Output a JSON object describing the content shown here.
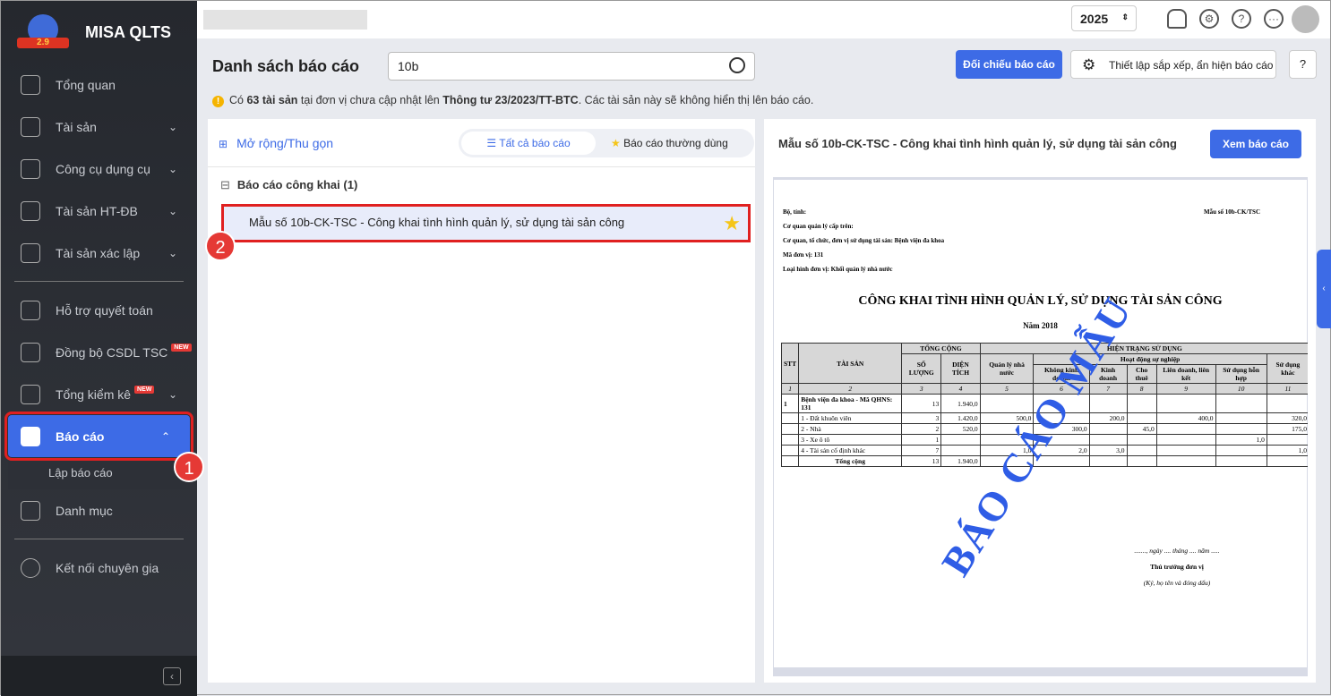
{
  "app": {
    "name": "MISA QLTS",
    "logo_text": "2.9"
  },
  "sidebar": {
    "items": [
      {
        "label": "Tổng quan"
      },
      {
        "label": "Tài sản"
      },
      {
        "label": "Công cụ dụng cụ"
      },
      {
        "label": "Tài sản HT-ĐB"
      },
      {
        "label": "Tài sản xác lập"
      },
      {
        "label": "Hỗ trợ quyết toán"
      },
      {
        "label": "Đồng bộ CSDL TSC",
        "badge": "NEW"
      },
      {
        "label": "Tổng kiểm kê",
        "badge": "NEW"
      },
      {
        "label": "Báo cáo"
      },
      {
        "label": "Lập báo cáo"
      },
      {
        "label": "Danh mục"
      },
      {
        "label": "Kết nối chuyên gia"
      }
    ]
  },
  "callouts": [
    "1",
    "2"
  ],
  "topbar": {
    "year": "2025"
  },
  "page": {
    "title": "Danh sách báo cáo",
    "search_value": "10b",
    "compare_button": "Đối chiếu báo cáo",
    "settings_button": "Thiết lập sắp xếp, ẩn hiện báo cáo",
    "info_pre": "Có ",
    "info_count": "63 tài sản",
    "info_mid": " tại đơn vị chưa cập nhật lên ",
    "info_circular": "Thông tư 23/2023/TT-BTC",
    "info_post": ". Các tài sản này sẽ không hiển thị lên báo cáo."
  },
  "list": {
    "expand_label": "Mở rộng/Thu gọn",
    "tab_all": "Tất cả báo cáo",
    "tab_frequent": "Báo cáo thường dùng",
    "group": "Báo cáo công khai (1)",
    "report": "Mẫu số 10b-CK-TSC - Công khai tình hình quản lý, sử dụng tài sản công"
  },
  "preview": {
    "title": "Mẫu số 10b-CK-TSC - Công khai tình hình quản lý, sử dụng tài sản công",
    "view_button": "Xem báo cáo",
    "doc": {
      "form_no": "Mẫu số 10b-CK/TSC",
      "meta": [
        "Bộ, tỉnh:",
        "Cơ quan quản lý cấp trên:",
        "Cơ quan, tổ chức, đơn vị sử dụng tài sản: Bệnh viện đa khoa",
        "Mã đơn vị: 131",
        "Loại hình đơn vị: Khối quản lý nhà nước"
      ],
      "title": "CÔNG KHAI TÌNH HÌNH QUẢN LÝ, SỬ DỤNG TÀI SẢN CÔNG",
      "year": "Năm 2018",
      "h": {
        "stt": "STT",
        "asset": "TÀI SẢN",
        "total": "TỔNG CỘNG",
        "current": "HIỆN TRẠNG SỬ DỤNG",
        "qty": "SỐ LƯỢNG",
        "area": "DIỆN TÍCH",
        "state": "Quản lý nhà nước",
        "career": "Hoạt động sự nghiệp",
        "nonbiz": "Không kinh doanh",
        "biz": "Kinh doanh",
        "rent": "Cho thuê",
        "jv": "Liên doanh, liên kết",
        "mixed": "Sử dụng hỗn hợp",
        "other": "Sử dụng khác"
      },
      "col_numbers": [
        "1",
        "2",
        "3",
        "4",
        "5",
        "6",
        "7",
        "8",
        "9",
        "10",
        "11"
      ],
      "rows": [
        [
          "1",
          "Bệnh viện đa khoa - Mã QHNS: 131",
          "13",
          "1.940,0",
          "",
          "",
          "",
          "",
          "",
          "",
          ""
        ],
        [
          "",
          "1 - Đất khuôn viên",
          "3",
          "1.420,0",
          "500,0",
          "",
          "200,0",
          "",
          "400,0",
          "",
          "320,0"
        ],
        [
          "",
          "2 - Nhà",
          "2",
          "520,0",
          "",
          "300,0",
          "",
          "45,0",
          "",
          "",
          "175,0"
        ],
        [
          "",
          "3 - Xe ô tô",
          "1",
          "",
          "",
          "",
          "",
          "",
          "",
          "1,0",
          ""
        ],
        [
          "",
          "4 - Tài sản cố định khác",
          "7",
          "",
          "1,0",
          "2,0",
          "3,0",
          "",
          "",
          "",
          "1,0"
        ],
        [
          "",
          "Tổng cộng",
          "13",
          "1.940,0",
          "",
          "",
          "",
          "",
          "",
          "",
          ""
        ]
      ],
      "date_line": "......., ngày .... tháng .... năm .....",
      "signer": "Thủ trưởng đơn vị",
      "sign_note": "(Ký, họ tên và đóng dấu)",
      "watermark": "BÁO CÁO MẪU"
    }
  }
}
